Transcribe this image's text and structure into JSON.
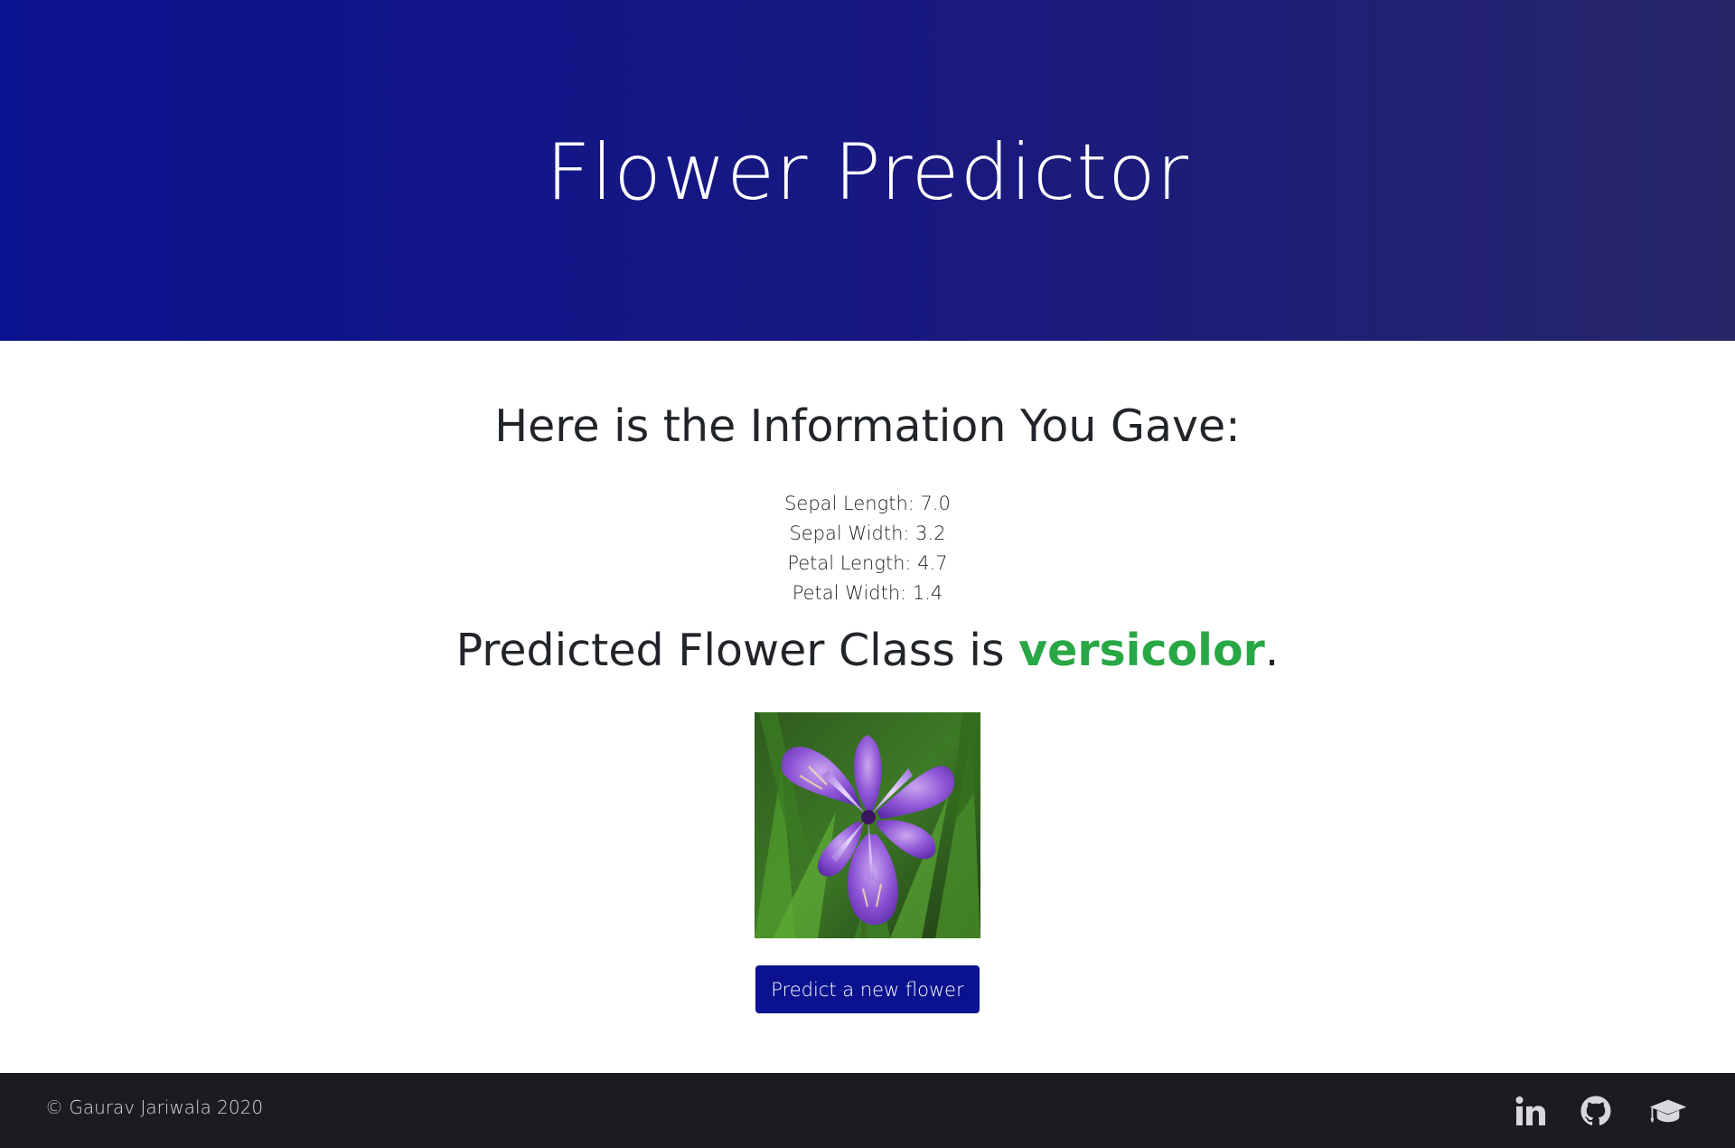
{
  "header": {
    "title": "Flower Predictor"
  },
  "info": {
    "heading": "Here is the Information You Gave:",
    "measurements": [
      "Sepal Length: 7.0",
      "Sepal Width: 3.2",
      "Petal Length: 4.7",
      "Petal Width: 1.4"
    ]
  },
  "prediction": {
    "prefix": "Predicted Flower Class is ",
    "class_name": "versicolor",
    "suffix": ".",
    "class_color": "#28a745"
  },
  "image": {
    "icon": "iris-flower-photo"
  },
  "actions": {
    "predict_new_label": "Predict a new flower"
  },
  "footer": {
    "copyright": "© Gaurav Jariwala 2020",
    "social": [
      {
        "icon": "linkedin-icon"
      },
      {
        "icon": "github-icon"
      },
      {
        "icon": "graduation-cap-icon"
      }
    ]
  },
  "colors": {
    "brand": "#0b128f",
    "footer_bg": "#1b1b22",
    "success": "#28a745"
  }
}
